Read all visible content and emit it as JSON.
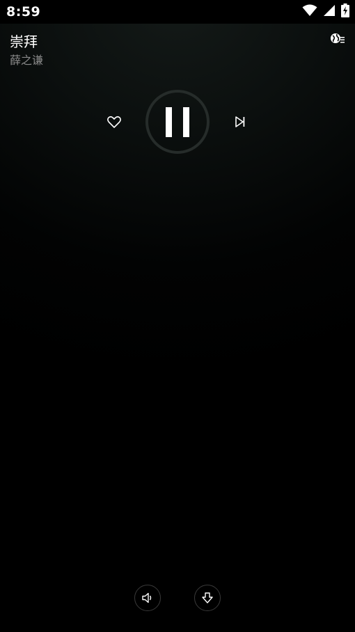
{
  "status_bar": {
    "time": "8:59",
    "icons": [
      "wifi-icon",
      "signal-icon",
      "battery-charging-icon"
    ]
  },
  "song": {
    "title": "崇拜",
    "artist": "薛之谦"
  },
  "controls": {
    "like_icon": "heart-outline-icon",
    "play_state": "playing",
    "play_pause_icon": "pause-icon",
    "next_icon": "skip-next-icon"
  },
  "top_right": {
    "icon": "globe-playlist-icon"
  },
  "bottom": {
    "volume_icon": "volume-icon",
    "download_icon": "download-icon"
  },
  "colors": {
    "background": "#000000",
    "text_primary": "#ffffff",
    "text_secondary": "#8a8a8a",
    "ring": "#2a302e"
  }
}
